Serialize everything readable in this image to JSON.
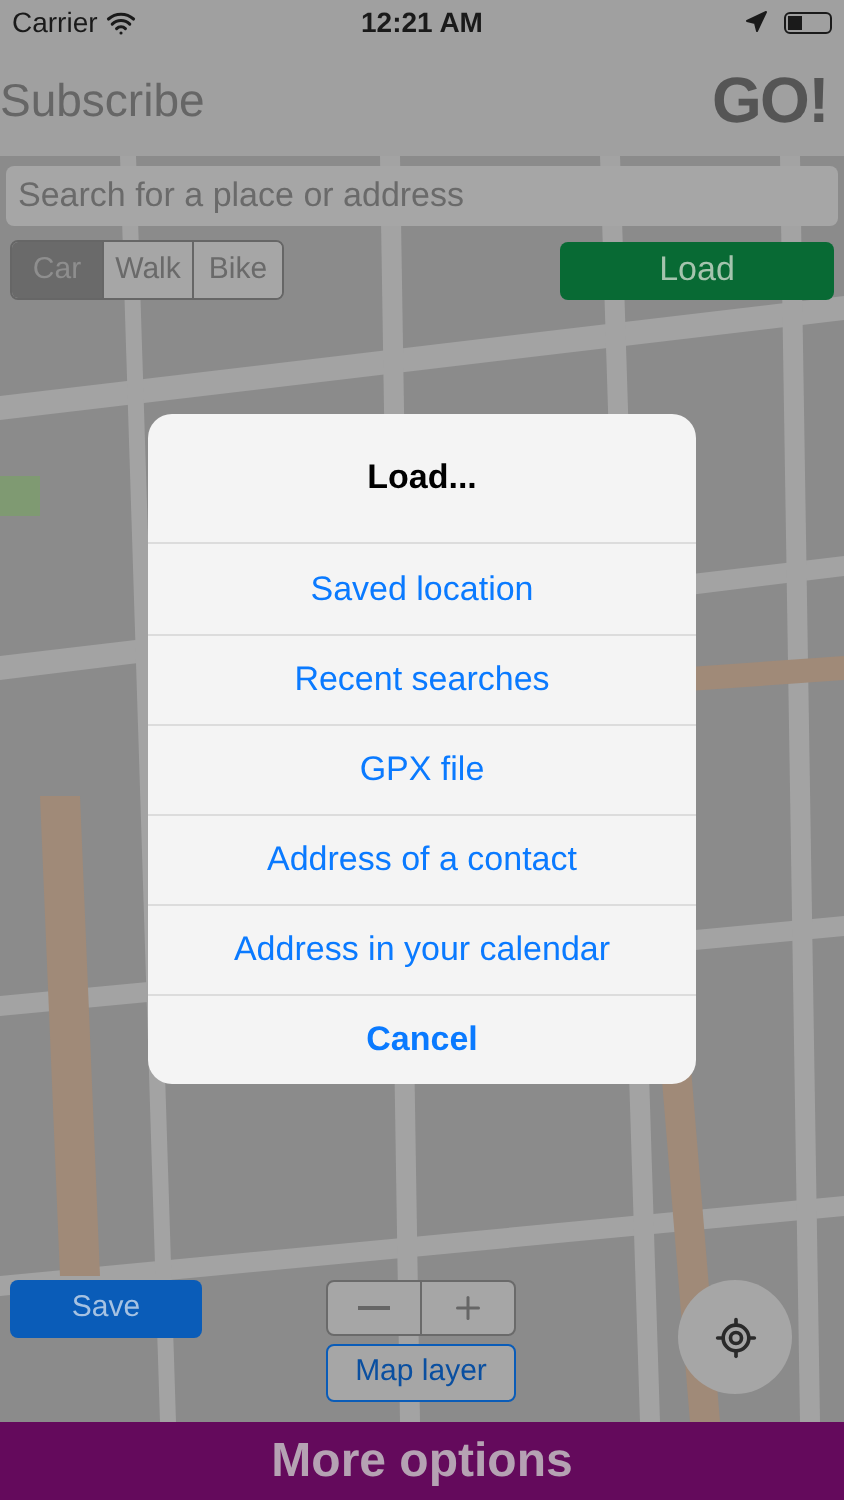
{
  "status_bar": {
    "carrier": "Carrier",
    "time": "12:21 AM"
  },
  "header": {
    "title": "Subscribe",
    "logo": "GO!"
  },
  "search": {
    "placeholder": "Search for a place or address"
  },
  "modes": [
    {
      "label": "Car",
      "selected": true
    },
    {
      "label": "Walk",
      "selected": false
    },
    {
      "label": "Bike",
      "selected": false
    }
  ],
  "load_button": "Load",
  "dialog": {
    "title": "Load...",
    "options": [
      {
        "label": "Saved location",
        "kind": "option"
      },
      {
        "label": "Recent searches",
        "kind": "option"
      },
      {
        "label": "GPX file",
        "kind": "option"
      },
      {
        "label": "Address of a contact",
        "kind": "option"
      },
      {
        "label": "Address in your calendar",
        "kind": "option"
      },
      {
        "label": "Cancel",
        "kind": "cancel"
      }
    ]
  },
  "save_button": "Save",
  "map_layer_button": "Map layer",
  "more_options": "More options"
}
